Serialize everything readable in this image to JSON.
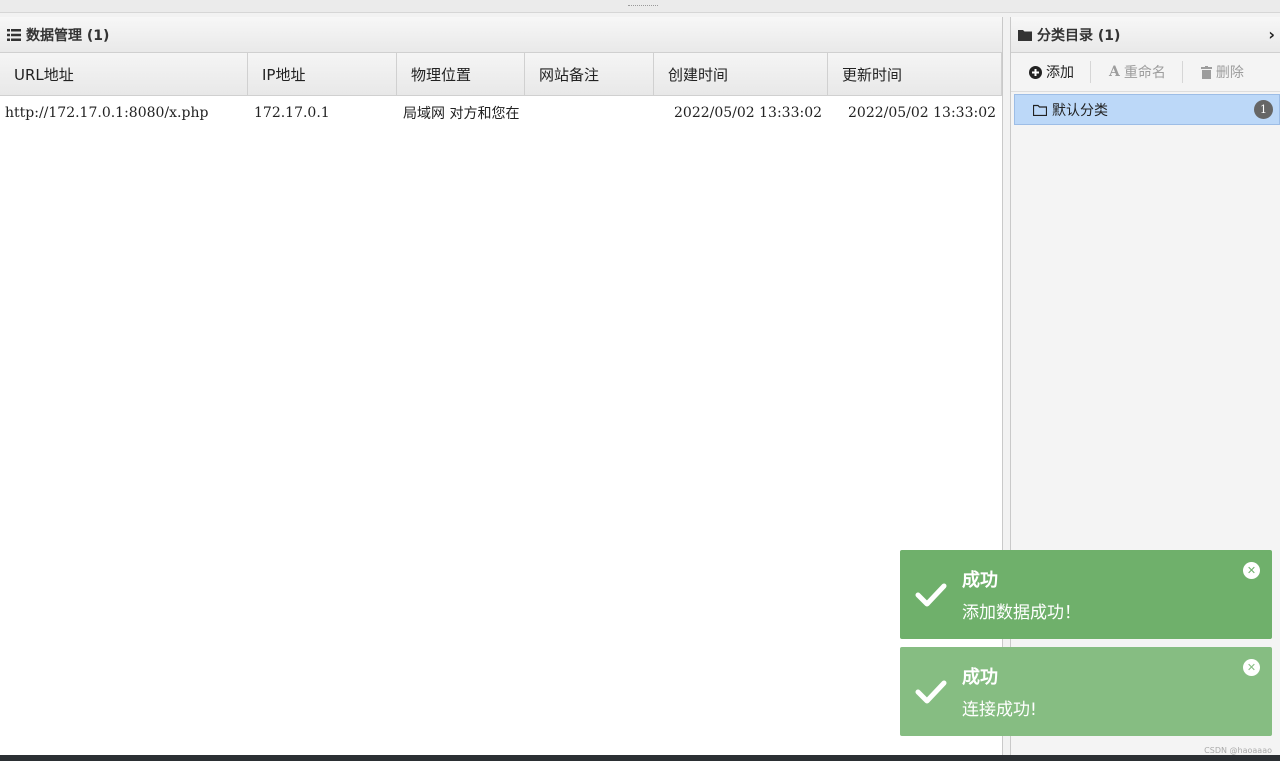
{
  "left_panel": {
    "title": "数据管理 (1)",
    "columns": [
      "URL地址",
      "IP地址",
      "物理位置",
      "网站备注",
      "创建时间",
      "更新时间"
    ],
    "rows": [
      [
        "http://172.17.0.1:8080/x.php",
        "172.17.0.1",
        "局域网 对方和您在",
        "",
        "2022/05/02 13:33:02",
        "2022/05/02 13:33:02"
      ]
    ]
  },
  "right_panel": {
    "title": "分类目录 (1)",
    "toolbar": {
      "add_label": "添加",
      "rename_label": "重命名",
      "delete_label": "删除"
    },
    "categories": [
      {
        "label": "默认分类",
        "count": "1"
      }
    ]
  },
  "toasts": [
    {
      "title": "成功",
      "message": "添加数据成功！",
      "color": "#6fb06b"
    },
    {
      "title": "成功",
      "message": "连接成功!",
      "color": "#86bd82"
    }
  ],
  "watermark": "CSDN @haoaaao"
}
